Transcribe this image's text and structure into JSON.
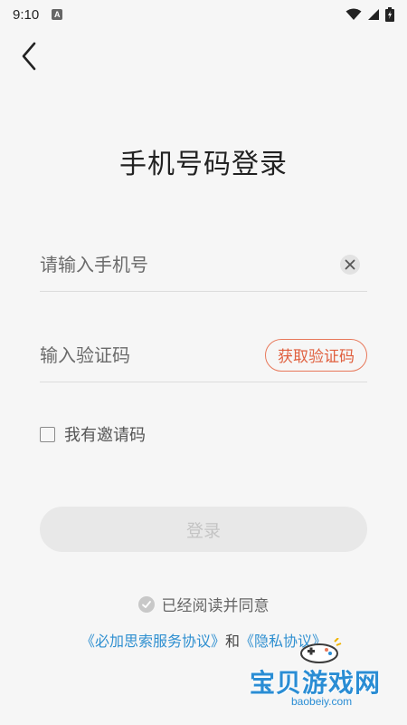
{
  "status_bar": {
    "time": "9:10",
    "notification_glyph": "A",
    "icons": [
      "wifi-icon",
      "signal-icon",
      "battery-icon"
    ]
  },
  "header": {
    "title": "手机号码登录",
    "back_icon": "back-chevron-icon"
  },
  "phone_field": {
    "placeholder": "请输入手机号",
    "value": "",
    "clear_icon": "clear-x-icon"
  },
  "code_field": {
    "placeholder": "输入验证码",
    "value": "",
    "get_code_label": "获取验证码"
  },
  "invite": {
    "label": "我有邀请码",
    "checked": false
  },
  "login_button": {
    "label": "登录",
    "enabled": false
  },
  "agreement": {
    "text": "已经阅读并同意",
    "service_link": "《必加思索服务协议》",
    "conjunction": "和",
    "privacy_link": "《隐私协议》"
  },
  "watermark": {
    "title": "宝贝游戏网",
    "domain": "baobeiy.com"
  },
  "colors": {
    "accent": "#e0603f",
    "link": "#2e8fd0",
    "background": "#f6f6f6"
  }
}
